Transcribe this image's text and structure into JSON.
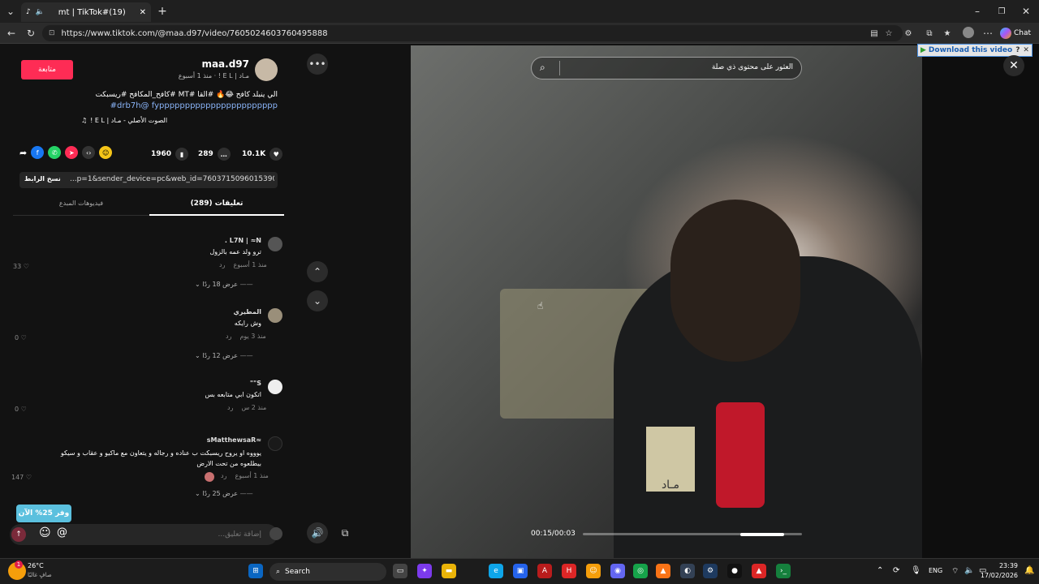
{
  "browser": {
    "tab_title": "mt | TikTok#(19)",
    "url": "https://www.tiktok.com/@maa.d97/video/7605024603760495888",
    "chat_label": "Chat",
    "download_label": "Download this video"
  },
  "post": {
    "follow_label": "متابعة",
    "username": "maa.d97",
    "subtitle": "مـاد | E L ! · منذ 1 أسبوع",
    "caption_line1": "الي ينبلد كافح 😂🔥 #القا #MT #كافح_المكافح #ريسبكت",
    "caption_line2": "drb7h@ fyppppppppppppppppppppppp#",
    "sound": "الصوت الأصلي - مـاد | E L !",
    "likes": "10.1K",
    "comments": "289",
    "saves": "1960",
    "copy_link_label": "نسخ الرابط",
    "link_value": "...p=1&sender_device=pc&web_id=7603715096015390215",
    "tab_comments": "(289) تعليقات",
    "tab_creator_videos": "فيديوهات المبدع"
  },
  "comments": [
    {
      "author": "L7N | ≈N .",
      "text": "ترو ولد عمه بالزول",
      "time": "منذ 1 أسبوع",
      "reply": "رد",
      "likes": "33",
      "view_replies": "عرض 18 ردًا"
    },
    {
      "author": "المطيري",
      "text": "وش رايكه",
      "time": "منذ 3 يوم",
      "reply": "رد",
      "likes": "0",
      "view_replies": "عرض 12 ردًا"
    },
    {
      "author": "S\"\"",
      "text": "اتكون ابي متابعه بس",
      "time": "منذ 2 س",
      "reply": "رد",
      "likes": "0",
      "view_replies": ""
    },
    {
      "author": "≈sMatthewsaR",
      "text": "يوووه او يروح ريسبكت ب عناده و رجاله و يتعاون مع ماكيو و عقاب و سيكو بيطلعوه من تحت الارض",
      "time": "منذ 1 أسبوع",
      "reply": "رد",
      "likes": "147",
      "view_replies": "عرض 25 ردًا"
    }
  ],
  "save_badge": "وفر 25% الآن",
  "comment_input_placeholder": "إضافة تعليق...",
  "video": {
    "search_placeholder": "العثور على محتوى ذي صلة",
    "time": "00:15/00:03",
    "progress": 0.72,
    "mic_label": "مـاد"
  },
  "taskbar": {
    "weather_temp": "26°C",
    "weather_desc": "صافٍ غالبًا",
    "search_label": "Search",
    "lang": "ENG",
    "time": "23:39",
    "date": "17/02/2026"
  },
  "colors": {
    "accent": "#fe2c55",
    "link": "#8ab4f8"
  }
}
